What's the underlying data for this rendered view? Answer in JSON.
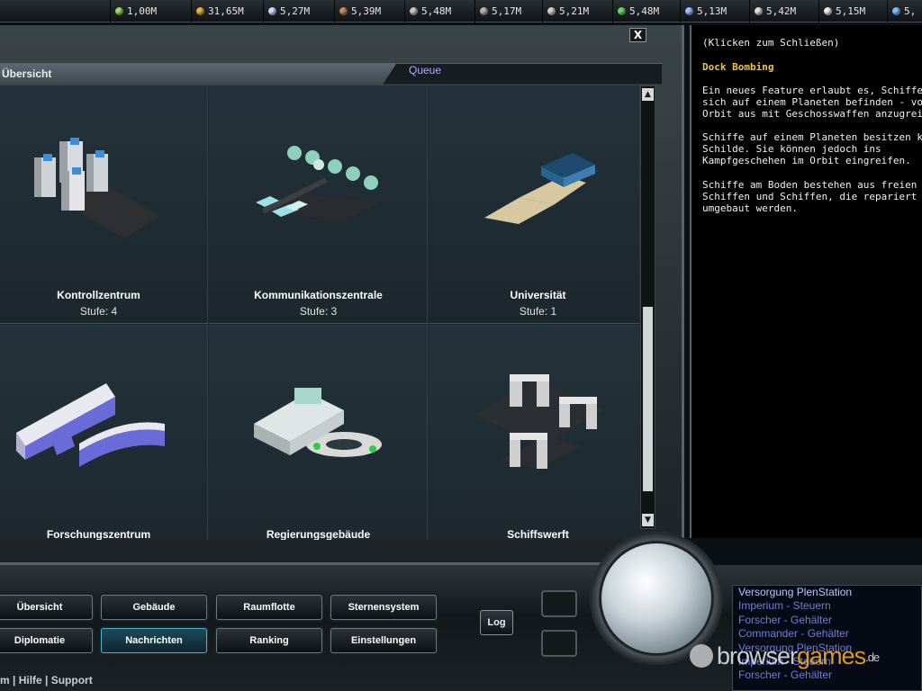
{
  "resources": [
    {
      "icon": "energy-icon",
      "value": "1,00M",
      "color": "#9fd86a"
    },
    {
      "icon": "gold-icon",
      "value": "31,65M",
      "color": "#e8b83a"
    },
    {
      "icon": "crystal-icon",
      "value": "5,27M",
      "color": "#d8d8ff"
    },
    {
      "icon": "ore-icon",
      "value": "5,39M",
      "color": "#c98a6a"
    },
    {
      "icon": "steel-icon",
      "value": "5,48M",
      "color": "#c8c8c8"
    },
    {
      "icon": "alloy-icon",
      "value": "5,17M",
      "color": "#b8b8b8"
    },
    {
      "icon": "chip-icon",
      "value": "5,21M",
      "color": "#d0d0d0"
    },
    {
      "icon": "bio-icon",
      "value": "5,48M",
      "color": "#6ad86a"
    },
    {
      "icon": "fuel-icon",
      "value": "5,13M",
      "color": "#a0c0ff"
    },
    {
      "icon": "gas-icon",
      "value": "5,42M",
      "color": "#e0e0e0"
    },
    {
      "icon": "food-icon",
      "value": "5,15M",
      "color": "#f0f0f0"
    },
    {
      "icon": "water-icon",
      "value": "5,",
      "color": "#80c0ff"
    }
  ],
  "tabs": {
    "overview": "Übersicht",
    "queue": "Queue"
  },
  "buildings": [
    {
      "name": "Kontrollzentrum",
      "level": "Stufe: 4"
    },
    {
      "name": "Kommunikationszentrale",
      "level": "Stufe: 3"
    },
    {
      "name": "Universität",
      "level": "Stufe: 1"
    },
    {
      "name": "Forschungszentrum",
      "level": ""
    },
    {
      "name": "Regierungsgebäude",
      "level": ""
    },
    {
      "name": "Schiffswerft",
      "level": ""
    }
  ],
  "close_label": "X",
  "scroll": {
    "up": "▲",
    "down": "▼"
  },
  "info": {
    "close_hint": "(Klicken zum Schließen)",
    "title": "Dock Bombing",
    "p1": "Ein neues Feature erlaubt es, Schiffe - die\nsich auf einem Planeten befinden - vom\nOrbit aus mit Geschosswaffen anzugreifen.",
    "p2": "Schiffe auf einem Planeten besitzen keine\nSchilde. Sie können jedoch ins\nKampfgeschehen im Orbit eingreifen.",
    "p3": "Schiffe am Boden bestehen aus freien\nSchiffen und Schiffen, die repariert oder\numgebaut werden."
  },
  "nav": {
    "overview": "Übersicht",
    "buildings": "Gebäude",
    "fleet": "Raumflotte",
    "star_system": "Sternensystem",
    "diplomacy": "Diplomatie",
    "messages": "Nachrichten",
    "ranking": "Ranking",
    "settings": "Einstellungen",
    "log": "Log"
  },
  "footer": "m | Hilfe | Support",
  "events": [
    "Versorgung PlenStation",
    "Imperium - Steuern",
    "Forscher - Gehälter",
    "Commander - Gehälter",
    "Versorgung PlenStation",
    "Imperium - Steuern",
    "Forscher - Gehälter"
  ],
  "watermark": {
    "part1": "browser",
    "part2": "games",
    "part3": ".de"
  }
}
